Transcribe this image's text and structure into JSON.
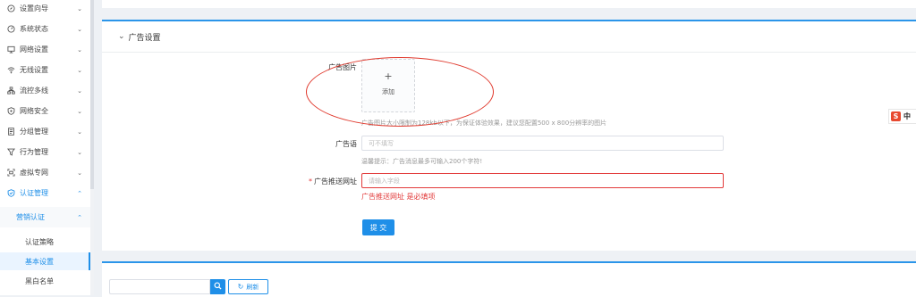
{
  "sidebar": {
    "items": [
      {
        "label": "设置向导",
        "icon": "compass-icon"
      },
      {
        "label": "系统状态",
        "icon": "gauge-icon"
      },
      {
        "label": "网络设置",
        "icon": "monitor-icon"
      },
      {
        "label": "无线设置",
        "icon": "wifi-icon"
      },
      {
        "label": "流控多线",
        "icon": "network-icon"
      },
      {
        "label": "网络安全",
        "icon": "shield-icon"
      },
      {
        "label": "分组管理",
        "icon": "document-icon"
      },
      {
        "label": "行为管理",
        "icon": "filter-icon"
      },
      {
        "label": "虚拟专网",
        "icon": "vpn-icon"
      },
      {
        "label": "认证管理",
        "icon": "shield-check-icon"
      }
    ],
    "submenu": {
      "label": "营销认证"
    },
    "leaves": [
      {
        "label": "认证策略"
      },
      {
        "label": "基本设置"
      },
      {
        "label": "黑白名单"
      }
    ]
  },
  "panel": {
    "title": "广告设置",
    "image_label": "广告图片",
    "upload_plus": "+",
    "upload_add": "添加",
    "image_hint": "广告图片大小限制为128kb以下，为保证体验效果，建议您配置500 x 800分辨率的图片",
    "slogan_label": "广告语",
    "slogan_placeholder": "可不填写",
    "slogan_hint": "温馨提示：广告消息最多可输入200个字符!",
    "url_required_mark": "*",
    "url_label": "广告推送网址",
    "url_placeholder": "请输入字段",
    "url_error": "广告推送网址 是必填项",
    "submit_label": "提 交"
  },
  "panel2": {
    "refresh_label": "刷新"
  },
  "ime": {
    "logo": "S",
    "mode": "中"
  },
  "colors": {
    "accent": "#1f8fe8",
    "error": "#e23a3a",
    "annotation": "#e03a2e"
  }
}
